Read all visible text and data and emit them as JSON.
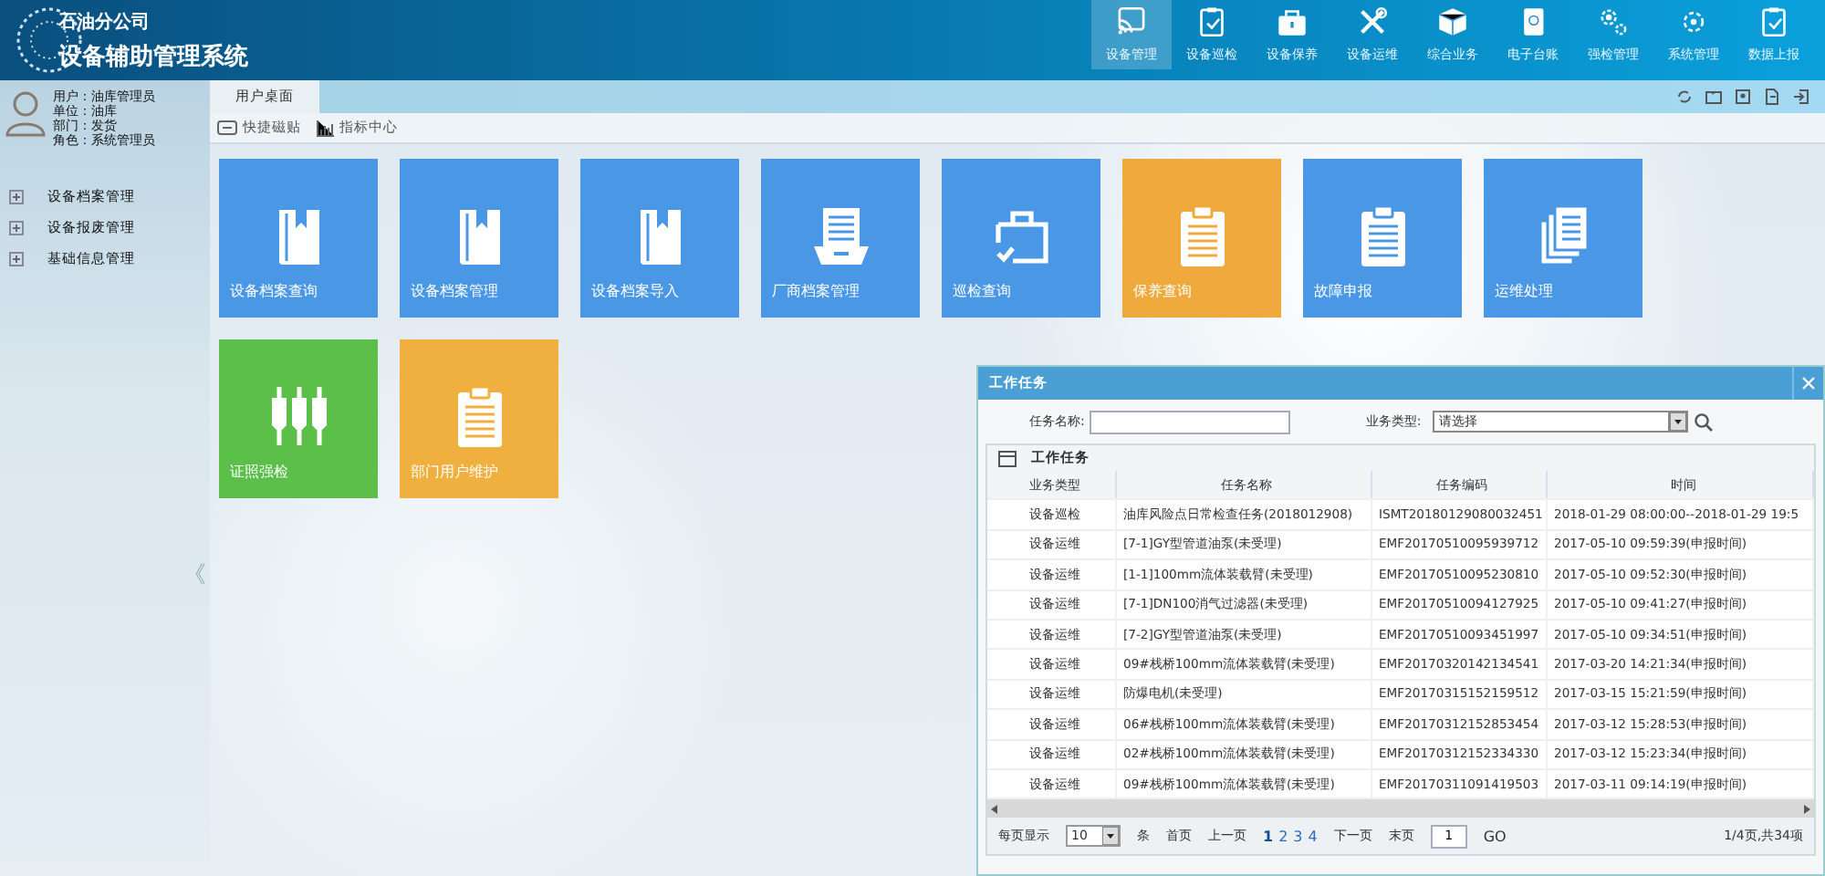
{
  "header": {
    "company": "石油分公司",
    "title": "设备辅助管理系统",
    "nav": [
      {
        "label": "设备管理",
        "kind": "cast",
        "selected": true
      },
      {
        "label": "设备巡检",
        "kind": "clipcheck",
        "selected": false
      },
      {
        "label": "设备保养",
        "kind": "bag",
        "selected": false
      },
      {
        "label": "设备运维",
        "kind": "tools",
        "selected": false
      },
      {
        "label": "综合业务",
        "kind": "box",
        "selected": false
      },
      {
        "label": "电子台账",
        "kind": "book",
        "selected": false
      },
      {
        "label": "强检管理",
        "kind": "gears",
        "selected": false
      },
      {
        "label": "系统管理",
        "kind": "gear",
        "selected": false
      },
      {
        "label": "数据上报",
        "kind": "clipcheck",
        "selected": false
      }
    ]
  },
  "user": {
    "lines": [
      "用户：油库管理员",
      "单位：油库",
      "部门：发货",
      "角色：系统管理员"
    ]
  },
  "sidebar": {
    "items": [
      {
        "label": "设备档案管理",
        "expanded": false
      },
      {
        "label": "设备报废管理",
        "expanded": false
      },
      {
        "label": "基础信息管理",
        "expanded": false
      }
    ],
    "collapse": "《"
  },
  "tabs": [
    {
      "label": "用户桌面",
      "selected": true
    }
  ],
  "toolbar": [
    {
      "label": "快捷磁贴",
      "kind": "tile"
    },
    {
      "label": "指标中心",
      "kind": "chart"
    }
  ],
  "tiles": [
    {
      "label": "设备档案查询",
      "kind": "book",
      "color": "#4a97e6"
    },
    {
      "label": "设备档案管理",
      "kind": "book",
      "color": "#4a97e6"
    },
    {
      "label": "设备档案导入",
      "kind": "book",
      "color": "#4a97e6"
    },
    {
      "label": "厂商档案管理",
      "kind": "tray",
      "color": "#4a97e6"
    },
    {
      "label": "巡检查询",
      "kind": "case",
      "color": "#4a97e6"
    },
    {
      "label": "保养查询",
      "kind": "clip",
      "color": "#f0a93c"
    },
    {
      "label": "故障申报",
      "kind": "clip",
      "color": "#4a97e6"
    },
    {
      "label": "运维处理",
      "kind": "docs",
      "color": "#4a97e6"
    },
    {
      "label": "证照强检",
      "kind": "plugs",
      "color": "#5cbf4a"
    },
    {
      "label": "部门用户维护",
      "kind": "clip",
      "color": "#f0b040"
    }
  ],
  "dialog": {
    "title": "工作任务",
    "name_label": "任务名称:",
    "type_label": "业务类型:",
    "type_value": "请选择",
    "grid_title": "工作任务",
    "columns": [
      "业务类型",
      "任务名称",
      "任务编码",
      "时间"
    ],
    "rows": [
      [
        "设备巡检",
        "油库风险点日常检查任务(2018012908)",
        "ISMT20180129080032451",
        "2018-01-29 08:00:00--2018-01-29 19:5"
      ],
      [
        "设备运维",
        "[7-1]GY型管道油泵(未受理)",
        "EMF20170510095939712",
        "2017-05-10 09:59:39(申报时间)"
      ],
      [
        "设备运维",
        "[1-1]100mm流体装载臂(未受理)",
        "EMF20170510095230810",
        "2017-05-10 09:52:30(申报时间)"
      ],
      [
        "设备运维",
        "[7-1]DN100消气过滤器(未受理)",
        "EMF20170510094127925",
        "2017-05-10 09:41:27(申报时间)"
      ],
      [
        "设备运维",
        "[7-2]GY型管道油泵(未受理)",
        "EMF20170510093451997",
        "2017-05-10 09:34:51(申报时间)"
      ],
      [
        "设备运维",
        "09#栈桥100mm流体装载臂(未受理)",
        "EMF20170320142134541",
        "2017-03-20 14:21:34(申报时间)"
      ],
      [
        "设备运维",
        "防爆电机(未受理)",
        "EMF20170315152159512",
        "2017-03-15 15:21:59(申报时间)"
      ],
      [
        "设备运维",
        "06#栈桥100mm流体装载臂(未受理)",
        "EMF20170312152853454",
        "2017-03-12 15:28:53(申报时间)"
      ],
      [
        "设备运维",
        "02#栈桥100mm流体装载臂(未受理)",
        "EMF20170312152334330",
        "2017-03-12 15:23:34(申报时间)"
      ],
      [
        "设备运维",
        "09#栈桥100mm流体装载臂(未受理)",
        "EMF20170311091419503",
        "2017-03-11 09:14:19(申报时间)"
      ]
    ],
    "pager": {
      "size_label": "每页显示",
      "size": "10",
      "unit": "条",
      "first": "首页",
      "prev": "上一页",
      "pages": [
        {
          "label": "1",
          "selected": true
        },
        {
          "label": "2",
          "selected": false
        },
        {
          "label": "3",
          "selected": false
        },
        {
          "label": "4",
          "selected": false
        }
      ],
      "next": "下一页",
      "last": "末页",
      "page_input": "1",
      "go": "GO",
      "summary": "1/4页,共34项"
    }
  }
}
